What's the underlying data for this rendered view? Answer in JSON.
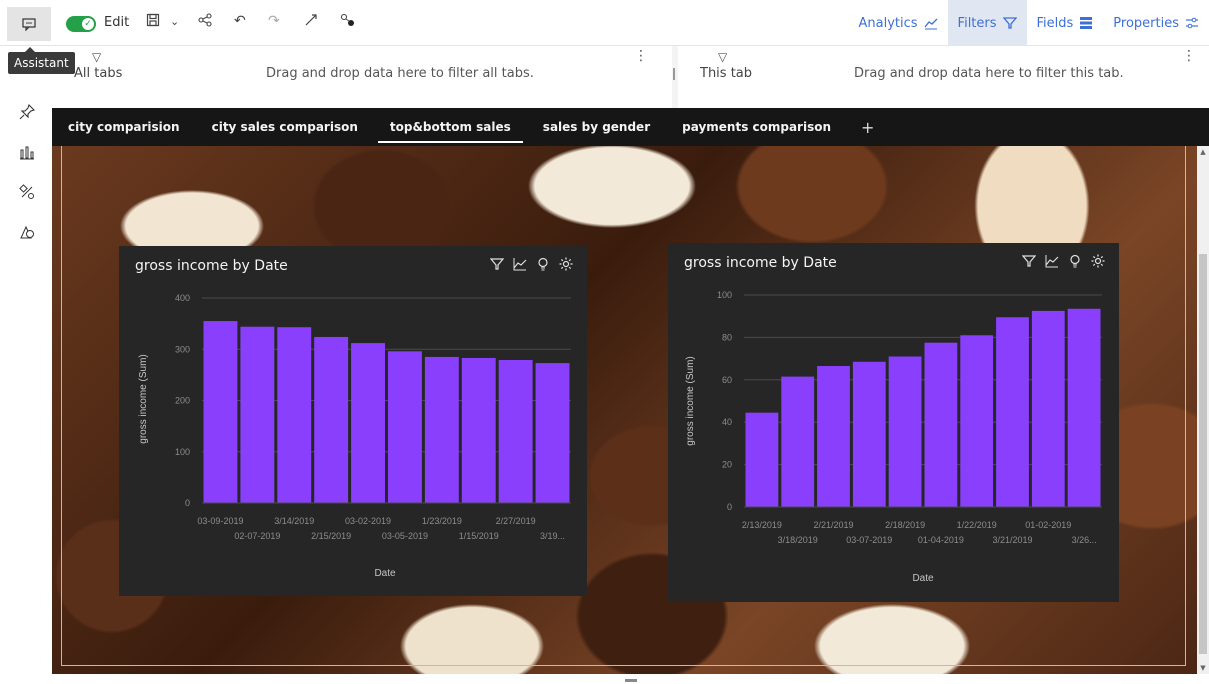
{
  "toolbar": {
    "edit_label": "Edit",
    "tooltip": "Assistant",
    "right_links": [
      {
        "label": "Analytics",
        "icon": "analytics-icon",
        "active": false
      },
      {
        "label": "Filters",
        "icon": "filter-icon",
        "active": true
      },
      {
        "label": "Fields",
        "icon": "fields-icon",
        "active": false
      },
      {
        "label": "Properties",
        "icon": "properties-icon",
        "active": false
      }
    ]
  },
  "filter_bar": {
    "all_tabs_label": "All tabs",
    "all_tabs_hint": "Drag and drop data here to filter all tabs.",
    "this_tab_label": "This tab",
    "this_tab_hint": "Drag and drop data here to filter this tab."
  },
  "tabs": [
    {
      "label": "city comparision",
      "active": false
    },
    {
      "label": "city sales comparison",
      "active": false
    },
    {
      "label": "top&bottom sales",
      "active": true
    },
    {
      "label": "sales by gender",
      "active": false
    },
    {
      "label": "payments comparison",
      "active": false
    }
  ],
  "tab_add": "+",
  "colors": {
    "bar": "#8a3ffc",
    "widget_bg": "#262626",
    "accent": "#3d70d6",
    "toggle": "#24a148"
  },
  "chart_data": [
    {
      "type": "bar",
      "title": "gross income by Date",
      "xlabel": "Date",
      "ylabel": "gross income (Sum)",
      "ylim": [
        0,
        400
      ],
      "yticks": [
        0,
        100,
        200,
        300,
        400
      ],
      "categories": [
        "03-09-2019",
        "02-07-2019",
        "3/14/2019",
        "2/15/2019",
        "03-02-2019",
        "03-05-2019",
        "1/23/2019",
        "1/15/2019",
        "2/27/2019",
        "3/19..."
      ],
      "values": [
        355,
        344,
        343,
        324,
        312,
        296,
        285,
        283,
        279,
        273
      ]
    },
    {
      "type": "bar",
      "title": "gross income by Date",
      "xlabel": "Date",
      "ylabel": "gross income (Sum)",
      "ylim": [
        0,
        100
      ],
      "yticks": [
        0,
        20,
        40,
        60,
        80,
        100
      ],
      "categories": [
        "2/13/2019",
        "3/18/2019",
        "2/21/2019",
        "03-07-2019",
        "2/18/2019",
        "01-04-2019",
        "1/22/2019",
        "3/21/2019",
        "01-02-2019",
        "3/26..."
      ],
      "values": [
        44.5,
        61.5,
        66.5,
        68.5,
        71,
        77.5,
        81,
        89.5,
        92.5,
        93.5
      ]
    }
  ]
}
